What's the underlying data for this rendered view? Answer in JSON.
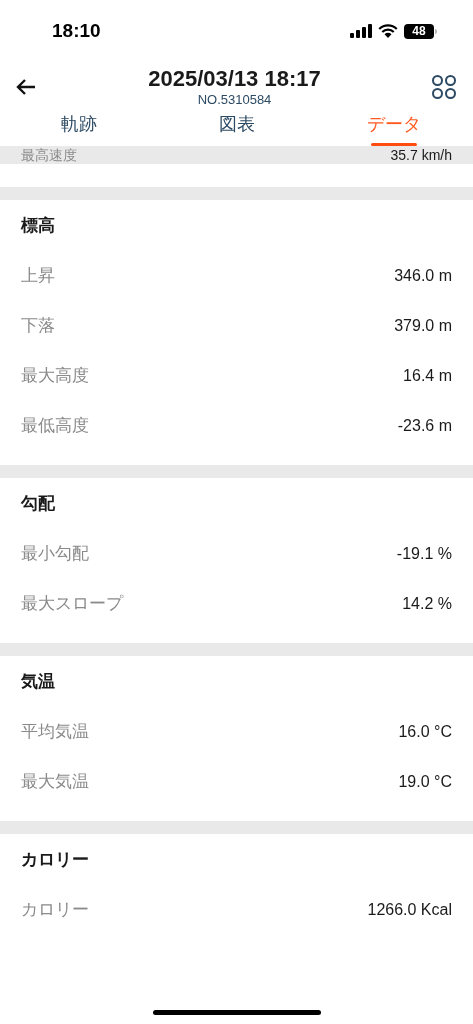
{
  "status_bar": {
    "time": "18:10",
    "battery": "48"
  },
  "header": {
    "title": "2025/03/13 18:17",
    "subtitle": "NO.5310584"
  },
  "tabs": [
    {
      "label": "軌跡",
      "selected": false
    },
    {
      "label": "図表",
      "selected": false
    },
    {
      "label": "データ",
      "selected": true
    }
  ],
  "partial_row": {
    "label": "最高速度",
    "value": "35.7 km/h"
  },
  "sections": [
    {
      "title": "標高",
      "rows": [
        {
          "label": "上昇",
          "value": "346.0 m"
        },
        {
          "label": "下落",
          "value": "379.0 m"
        },
        {
          "label": "最大高度",
          "value": "16.4 m"
        },
        {
          "label": "最低高度",
          "value": "-23.6 m"
        }
      ]
    },
    {
      "title": "勾配",
      "rows": [
        {
          "label": "最小勾配",
          "value": "-19.1 %"
        },
        {
          "label": "最大スロープ",
          "value": "14.2 %"
        }
      ]
    },
    {
      "title": "気温",
      "rows": [
        {
          "label": "平均気温",
          "value": "16.0 °C"
        },
        {
          "label": "最大気温",
          "value": "19.0 °C"
        }
      ]
    },
    {
      "title": "カロリー",
      "rows": [
        {
          "label": "カロリー",
          "value": "1266.0 Kcal"
        }
      ]
    }
  ]
}
